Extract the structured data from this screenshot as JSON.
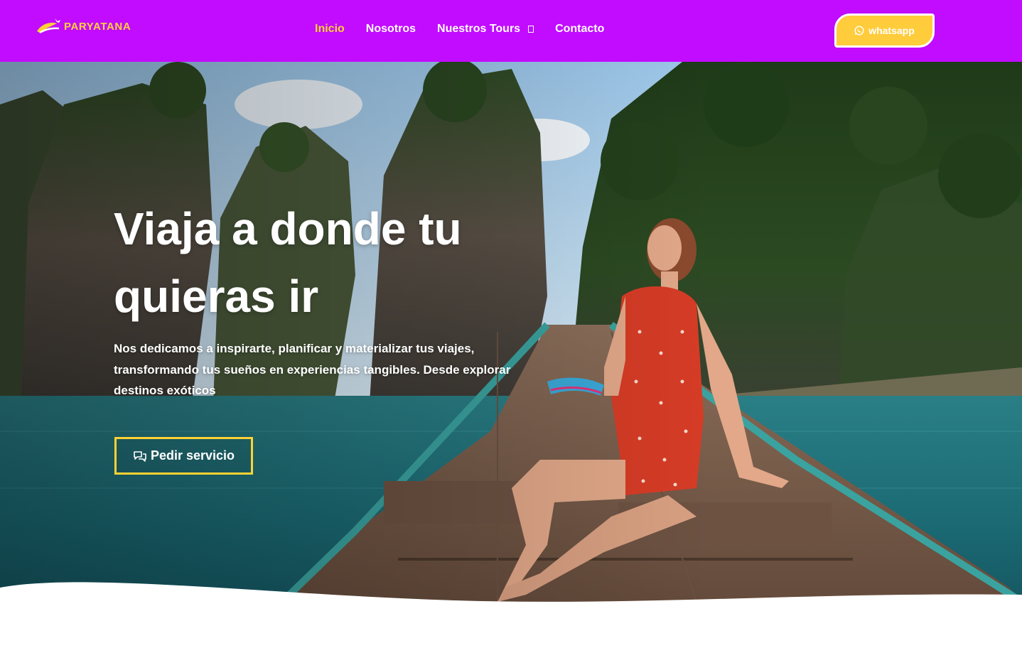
{
  "brand": {
    "name": "PARYATANA",
    "accent": "#c10cff",
    "gold": "#ffd234",
    "button_yellow": "#ffcc3c"
  },
  "nav": {
    "items": [
      {
        "label": "Inicio",
        "active": true
      },
      {
        "label": "Nosotros",
        "active": false
      },
      {
        "label": "Nuestros Tours",
        "active": false,
        "icon": "dropdown-box-icon"
      },
      {
        "label": "Contacto",
        "active": false
      }
    ]
  },
  "header": {
    "whatsapp_label": "whatsapp",
    "whatsapp_icon": "whatsapp-icon"
  },
  "hero": {
    "title_line1": "Viaja a donde tu",
    "title_line2": "quieras ir",
    "description": "Nos dedicamos a inspirarte, planificar y materializar tus viajes, transformando tus sueños en experiencias tangibles. Desde explorar destinos exóticos",
    "cta_label": "Pedir servicio",
    "cta_icon": "chat-bubbles-icon",
    "image": "woman-on-longtail-boat-lake-karst-cliffs"
  }
}
